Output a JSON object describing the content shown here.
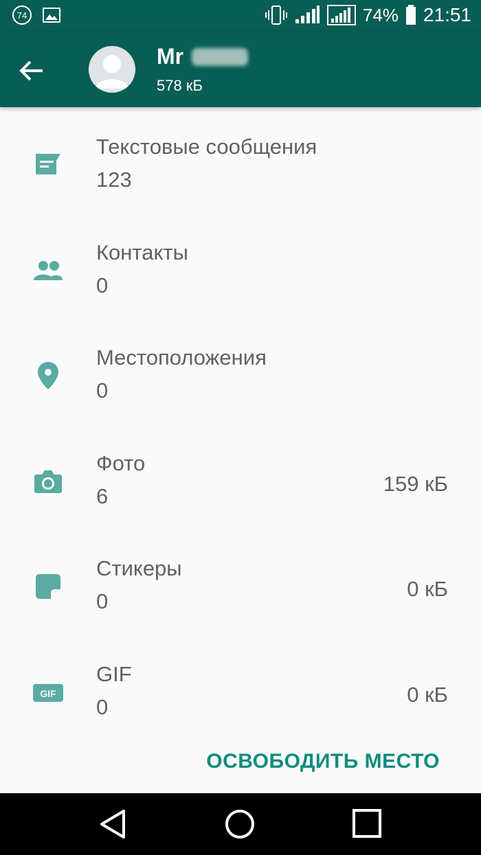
{
  "status_bar": {
    "notification_badge": "74",
    "battery_percent": "74%",
    "time": "21:51"
  },
  "header": {
    "name": "Mr",
    "size": "578 кБ"
  },
  "rows": [
    {
      "title": "Текстовые сообщения",
      "count": "123",
      "size": "",
      "icon": "message-icon"
    },
    {
      "title": "Контакты",
      "count": "0",
      "size": "",
      "icon": "contacts-icon"
    },
    {
      "title": "Местоположения",
      "count": "0",
      "size": "",
      "icon": "location-pin-icon"
    },
    {
      "title": "Фото",
      "count": "6",
      "size": "159 кБ",
      "icon": "camera-icon"
    },
    {
      "title": "Стикеры",
      "count": "0",
      "size": "0 кБ",
      "icon": "sticker-icon"
    },
    {
      "title": "GIF",
      "count": "0",
      "size": "0 кБ",
      "icon": "gif-icon"
    }
  ],
  "actions": {
    "free_space": "ОСВОБОДИТЬ МЕСТО"
  },
  "colors": {
    "primary": "#075e54",
    "accent": "#128c7e",
    "icon": "#5aaba1"
  }
}
